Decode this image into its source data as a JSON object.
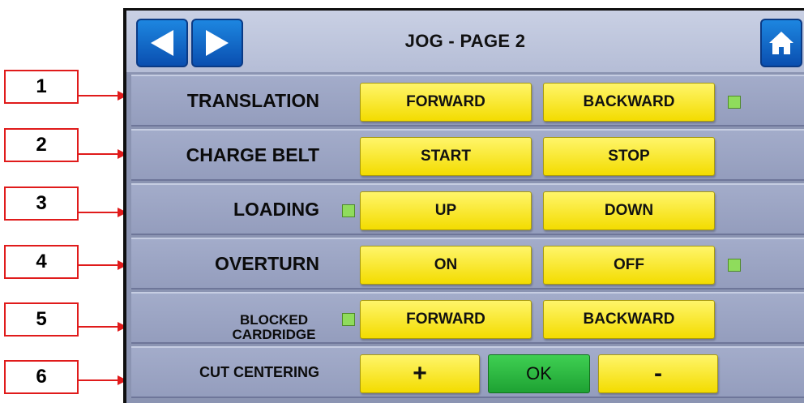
{
  "screen": {
    "title": "JOG - PAGE 2",
    "nav": {
      "back_icon": "left-arrow-icon",
      "forward_icon": "right-arrow-icon",
      "home_icon": "home-icon"
    }
  },
  "callouts": [
    "1",
    "2",
    "3",
    "4",
    "5",
    "6"
  ],
  "rows": [
    {
      "label": "TRANSLATION",
      "buttons": [
        "FORWARD",
        "BACKWARD"
      ],
      "indicator": "right"
    },
    {
      "label": "CHARGE BELT",
      "buttons": [
        "START",
        "STOP"
      ],
      "indicator": "none"
    },
    {
      "label": "LOADING",
      "buttons": [
        "UP",
        "DOWN"
      ],
      "indicator": "left"
    },
    {
      "label": "OVERTURN",
      "buttons": [
        "ON",
        "OFF"
      ],
      "indicator": "right"
    },
    {
      "label_lines": [
        "BLOCKED",
        "CARDRIDGE"
      ],
      "buttons": [
        "FORWARD",
        "BACKWARD"
      ],
      "indicator": "left"
    },
    {
      "label": "CUT CENTERING",
      "buttons": [
        "+",
        "OK",
        "-"
      ],
      "indicator": "none"
    }
  ],
  "colors": {
    "callout_border": "#e01b1b",
    "button_yellow": "#f3dc00",
    "button_ok_green": "#2bb43f",
    "indicator_green": "#8fdc5c",
    "nav_blue": "#1167c8",
    "panel_bg": "#8b94b2"
  }
}
